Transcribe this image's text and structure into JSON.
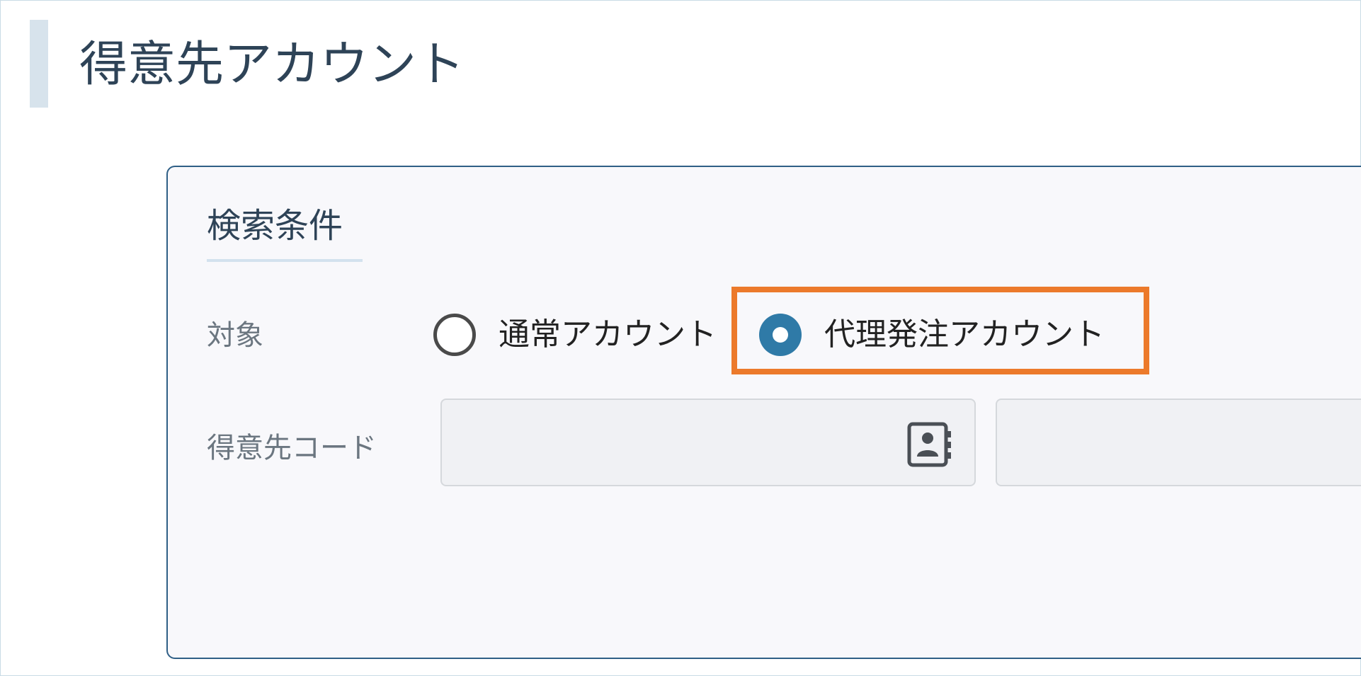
{
  "page": {
    "title": "得意先アカウント"
  },
  "search_panel": {
    "section_title": "検索条件",
    "target": {
      "label": "対象",
      "options": [
        {
          "label": "通常アカウント",
          "selected": false
        },
        {
          "label": "代理発注アカウント",
          "selected": true
        }
      ]
    },
    "customer_code": {
      "label": "得意先コード",
      "code_value": "",
      "name_value": "",
      "icon": "contact-book-icon"
    }
  },
  "colors": {
    "accent_blue": "#2f7aa7",
    "panel_border": "#2f5f86",
    "highlight_orange": "#ec7a2b",
    "title_text": "#2e4357"
  }
}
